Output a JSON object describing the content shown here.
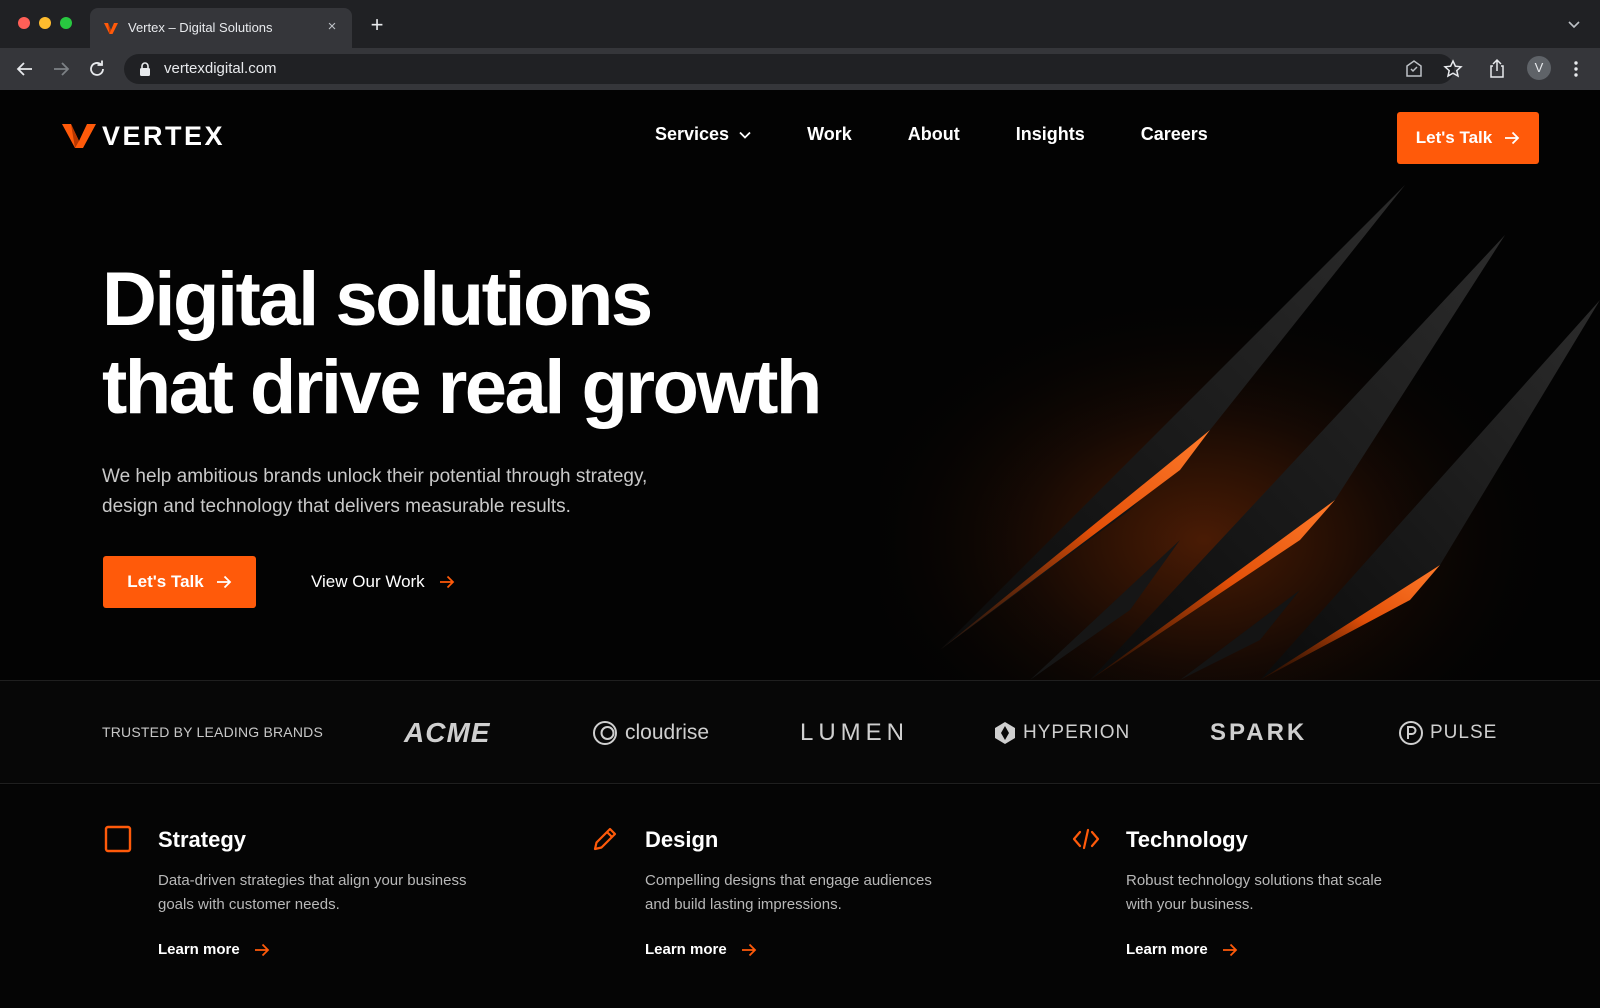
{
  "browser": {
    "tab_title": "Vertex – Digital Solutions",
    "tab_close": "×",
    "new_tab": "+",
    "url": "vertexdigital.com",
    "profile_initial": "V"
  },
  "nav": {
    "logo_text": "VERTEX",
    "links": [
      {
        "label": "Services",
        "has_dropdown": true
      },
      {
        "label": "Work"
      },
      {
        "label": "About"
      },
      {
        "label": "Insights"
      },
      {
        "label": "Careers"
      }
    ],
    "cta_label": "Let's Talk"
  },
  "hero": {
    "title_line1": "Digital solutions",
    "title_line2": "that drive real growth",
    "subtitle_line1": "We help ambitious brands unlock their potential through strategy,",
    "subtitle_line2": "design and technology that delivers measurable results.",
    "primary_cta": "Let's Talk",
    "secondary_cta": "View Our Work"
  },
  "brands": {
    "label": "TRUSTED BY LEADING BRANDS",
    "items": [
      "ACME",
      "cloudrise",
      "LUMEN",
      "HYPERION",
      "SPARK",
      "PULSE"
    ]
  },
  "services": [
    {
      "title": "Strategy",
      "icon": "square-icon",
      "desc_line1": "Data-driven strategies that align your business",
      "desc_line2": "goals with customer needs.",
      "link": "Learn more"
    },
    {
      "title": "Design",
      "icon": "pencil-icon",
      "desc_line1": "Compelling designs that engage audiences",
      "desc_line2": "and build lasting impressions.",
      "link": "Learn more"
    },
    {
      "title": "Technology",
      "icon": "code-icon",
      "desc_line1": "Robust technology solutions that scale",
      "desc_line2": "with your business.",
      "link": "Learn more"
    }
  ],
  "colors": {
    "accent": "#ff5a0a",
    "background": "#030303",
    "text": "#ffffff",
    "muted_text": "#c9c9c9"
  }
}
